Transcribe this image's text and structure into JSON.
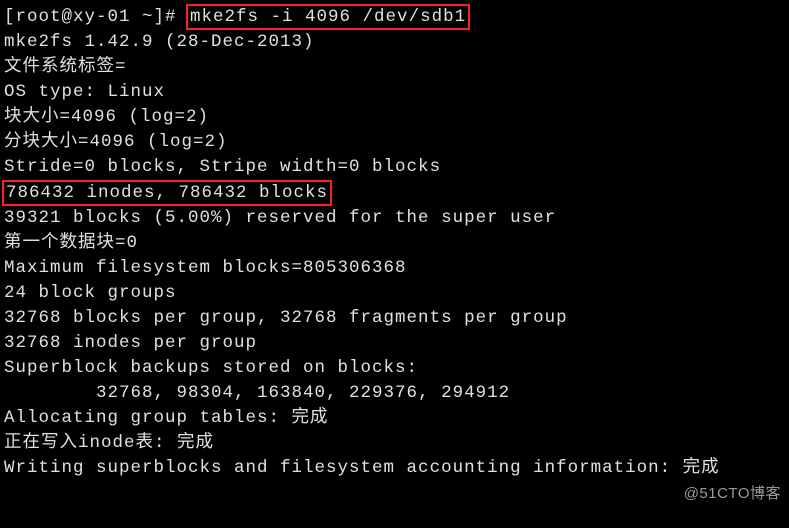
{
  "prompt": {
    "prefix": "[root@xy-01 ~]# ",
    "command": "mke2fs -i 4096 /dev/sdb1"
  },
  "lines": {
    "version": "mke2fs 1.42.9 (28-Dec-2013)",
    "fslabel": "文件系统标签=",
    "ostype": "OS type: Linux",
    "blocksize": "块大小=4096 (log=2)",
    "fragsize": "分块大小=4096 (log=2)",
    "stride": "Stride=0 blocks, Stripe width=0 blocks",
    "inodes_blocks": "786432 inodes, 786432 blocks",
    "reserved": "39321 blocks (5.00%) reserved for the super user",
    "firstdata": "第一个数据块=0",
    "maxfs": "Maximum filesystem blocks=805306368",
    "groups": "24 block groups",
    "pergroup": "32768 blocks per group, 32768 fragments per group",
    "inodespg": "32768 inodes per group",
    "sbbackups_hdr": "Superblock backups stored on blocks:",
    "sbbackups_vals": "\t32768, 98304, 163840, 229376, 294912",
    "blank": "",
    "alloc": "Allocating group tables: 完成",
    "writeinode": "正在写入inode表: 完成",
    "writesb": "Writing superblocks and filesystem accounting information: 完成"
  },
  "watermark": "@51CTO博客"
}
